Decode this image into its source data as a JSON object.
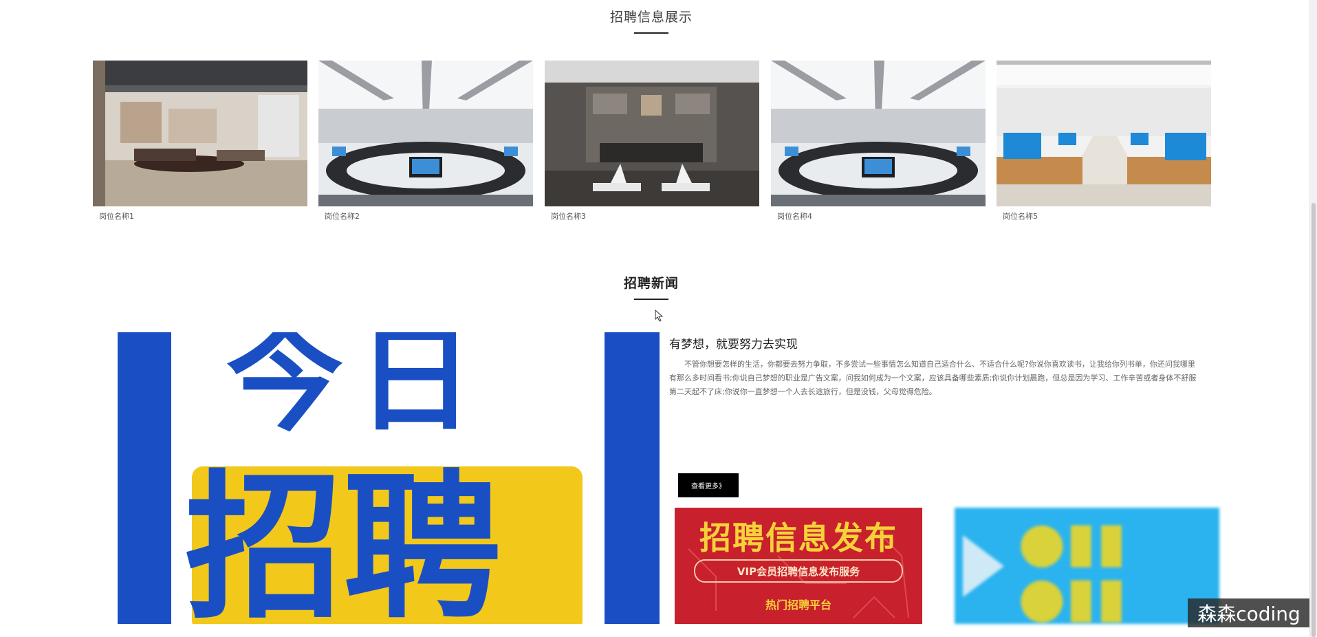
{
  "jobs_section": {
    "title": "招聘信息展示",
    "jobs": [
      {
        "name": "岗位名称1",
        "image": "office-lounge-image"
      },
      {
        "name": "岗位名称2",
        "image": "computer-lab-image"
      },
      {
        "name": "岗位名称3",
        "image": "executive-office-image"
      },
      {
        "name": "岗位名称4",
        "image": "computer-lab-image"
      },
      {
        "name": "岗位名称5",
        "image": "classroom-pc-image"
      }
    ]
  },
  "news_section": {
    "title": "招聘新闻",
    "poster_text_top": "今日",
    "poster_text_main": "招聘",
    "article": {
      "title": "有梦想，就要努力去实现",
      "body": "不管你想要怎样的生活，你都要去努力争取，不多尝试一些事情怎么知道自己适合什么、不适合什么呢?你说你喜欢读书，让我给你列书单，你还问我哪里有那么多时间看书;你说自己梦想的职业是广告文案，问我如何成为一个文案，应该具备哪些素质;你说你计划晨跑，但总是因为学习、工作辛苦或者身体不舒服第二天起不了床;你说你一直梦想一个人去长途旅行，但是没钱，父母觉得危险。",
      "more_label": "查看更多》"
    },
    "banner_red": {
      "title": "招聘信息发布",
      "pill": "VIP会员招聘信息发布服务",
      "sub": "热门招聘平台"
    }
  },
  "watermark": "森森coding",
  "colors": {
    "poster_blue": "#1a4fc4",
    "poster_yellow": "#f2c81b",
    "banner_red": "#c8202c",
    "banner_blue": "#2ab3ef",
    "button_black": "#000000"
  }
}
